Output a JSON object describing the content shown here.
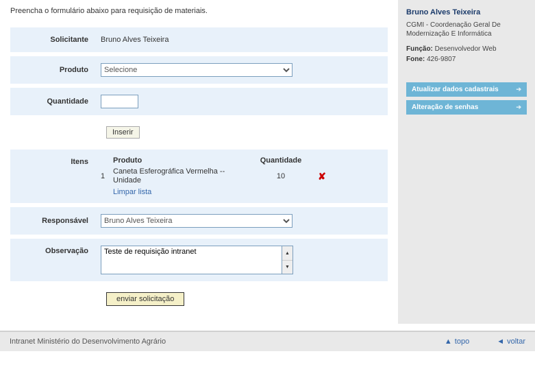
{
  "form": {
    "intro": "Preencha o formulário abaixo para requisição de materiais.",
    "labels": {
      "solicitante": "Solicitante",
      "produto": "Produto",
      "quantidade": "Quantidade",
      "itens": "Itens",
      "responsavel": "Responsável",
      "observacao": "Observação"
    },
    "solicitante_value": "Bruno Alves Teixeira",
    "produto_placeholder": "Selecione",
    "btn_inserir": "Inserir",
    "itens_header": {
      "produto": "Produto",
      "quantidade": "Quantidade"
    },
    "itens_rows": [
      {
        "num": "1",
        "produto": "Caneta Esferográfica Vermelha -- Unidade",
        "quantidade": "10"
      }
    ],
    "limpar_lista": "Limpar lista",
    "responsavel_value": "Bruno Alves Teixeira",
    "observacao_value": "Teste de requisição intranet",
    "btn_enviar": "enviar solicitação"
  },
  "sidebar": {
    "user_name": "Bruno Alves Teixeira",
    "user_dept": "CGMI - Coordenação Geral De Modernização E Informática",
    "funcao_label": "Função:",
    "funcao_value": "Desenvolvedor Web",
    "fone_label": "Fone:",
    "fone_value": "426-9807",
    "btn_atualizar": "Atualizar dados cadastrais",
    "btn_alteracao": "Alteração de senhas"
  },
  "footer": {
    "text": "Intranet Ministério do Desenvolvimento Agrário",
    "topo": "topo",
    "voltar": "voltar"
  }
}
